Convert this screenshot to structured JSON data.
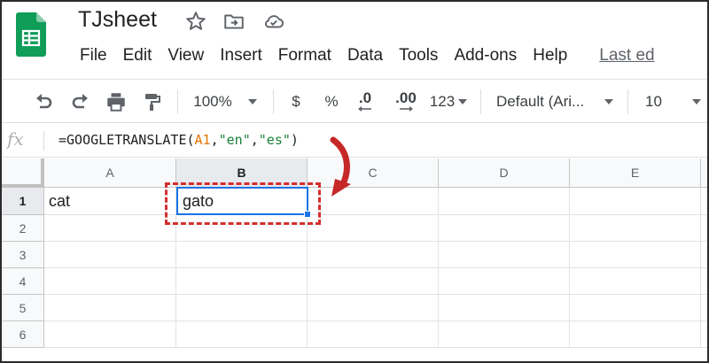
{
  "app": {
    "title": "TJsheet",
    "icons": [
      "star-icon",
      "move-to-folder-icon",
      "cloud-saved-icon"
    ]
  },
  "menu": {
    "items": [
      "File",
      "Edit",
      "View",
      "Insert",
      "Format",
      "Data",
      "Tools",
      "Add-ons",
      "Help"
    ],
    "last_edit": "Last ed"
  },
  "toolbar": {
    "zoom": "100%",
    "currency": "$",
    "percent": "%",
    "decrease_decimal": ".0",
    "increase_decimal": ".00",
    "more_formats": "123",
    "font": "Default (Ari...",
    "font_size": "10"
  },
  "formula_bar": {
    "fx_label": "fx",
    "parts": {
      "fn": "=GOOGLETRANSLATE(",
      "ref": "A1",
      "c1": ",",
      "s1": "\"en\"",
      "c2": ",",
      "s2": "\"es\"",
      "close": ")"
    }
  },
  "grid": {
    "columns": [
      "A",
      "B",
      "C",
      "D",
      "E"
    ],
    "rows": [
      "1",
      "2",
      "3",
      "4",
      "5",
      "6"
    ],
    "cells": {
      "A1": "cat",
      "B1": "gato"
    },
    "selected_cell": "B1"
  },
  "colors": {
    "sheets_green": "#0f9d58",
    "selection_blue": "#1a73e8",
    "annotation_red": "#d32f2f"
  }
}
